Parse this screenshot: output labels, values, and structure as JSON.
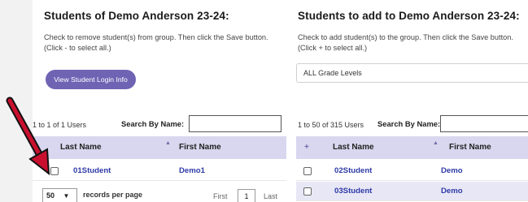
{
  "left": {
    "title": "Students of Demo Anderson 23-24:",
    "instructions": "Check to remove student(s) from group. Then click the Save button. (Click - to select all.)",
    "login_button": "View Student Login Info",
    "count": "1 to 1 of 1 Users",
    "search_label": "Search By Name:",
    "search_value": "",
    "columns": [
      "Last Name",
      "First Name"
    ],
    "rows": [
      {
        "last": "01Student",
        "first": "Demo1"
      }
    ],
    "page_size": "50",
    "records_label": "records per page",
    "first": "First",
    "page": "1",
    "last": "Last"
  },
  "right": {
    "title": "Students to add to Demo Anderson 23-24:",
    "instructions": "Check to add student(s) to the group. Then click the Save button. (Click + to select all.)",
    "grade_select": "ALL Grade Levels",
    "count": "1 to 50 of 315 Users",
    "search_label": "Search By Name:",
    "search_value": "",
    "select_all": "+",
    "columns": [
      "Last Name",
      "First Name"
    ],
    "rows": [
      {
        "last": "02Student",
        "first": "Demo"
      },
      {
        "last": "03Student",
        "first": "Demo"
      }
    ]
  },
  "colors": {
    "accent": "#6f63b4",
    "header_bg": "#d9d7ef",
    "link": "#2d3aa6",
    "annotation_arrow": "#c8102e"
  }
}
